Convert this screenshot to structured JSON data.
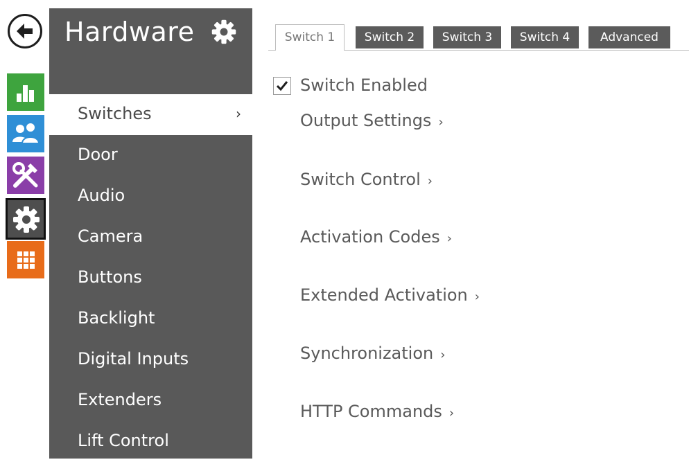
{
  "rail": {
    "items": [
      {
        "name": "status",
        "icon": "bar-chart-icon",
        "color": "#3ea43e"
      },
      {
        "name": "directory",
        "icon": "users-icon",
        "color": "#2f8fd6"
      },
      {
        "name": "services",
        "icon": "tools-icon",
        "color": "#8a3ea8"
      },
      {
        "name": "hardware",
        "icon": "gear-icon",
        "color": "#4e4e4e",
        "active": true
      },
      {
        "name": "system",
        "icon": "grid-icon",
        "color": "#e86c1a"
      }
    ]
  },
  "sidebar": {
    "title": "Hardware",
    "items": [
      {
        "label": "Switches",
        "active": true,
        "chevron": "›"
      },
      {
        "label": "Door"
      },
      {
        "label": "Audio"
      },
      {
        "label": "Camera"
      },
      {
        "label": "Buttons"
      },
      {
        "label": "Backlight"
      },
      {
        "label": "Digital Inputs"
      },
      {
        "label": "Extenders"
      },
      {
        "label": "Lift Control"
      }
    ]
  },
  "tabs": [
    {
      "label": "Switch 1",
      "active": true
    },
    {
      "label": "Switch 2"
    },
    {
      "label": "Switch 3"
    },
    {
      "label": "Switch 4"
    },
    {
      "label": "Advanced"
    }
  ],
  "main": {
    "switch_enabled": {
      "label": "Switch Enabled",
      "checked": true
    },
    "sections": [
      {
        "label": "Output Settings",
        "chevron": "›"
      },
      {
        "label": "Switch Control",
        "chevron": "›"
      },
      {
        "label": "Activation Codes",
        "chevron": "›"
      },
      {
        "label": "Extended Activation",
        "chevron": "›"
      },
      {
        "label": "Synchronization",
        "chevron": "›"
      },
      {
        "label": "HTTP Commands",
        "chevron": "›"
      }
    ]
  }
}
